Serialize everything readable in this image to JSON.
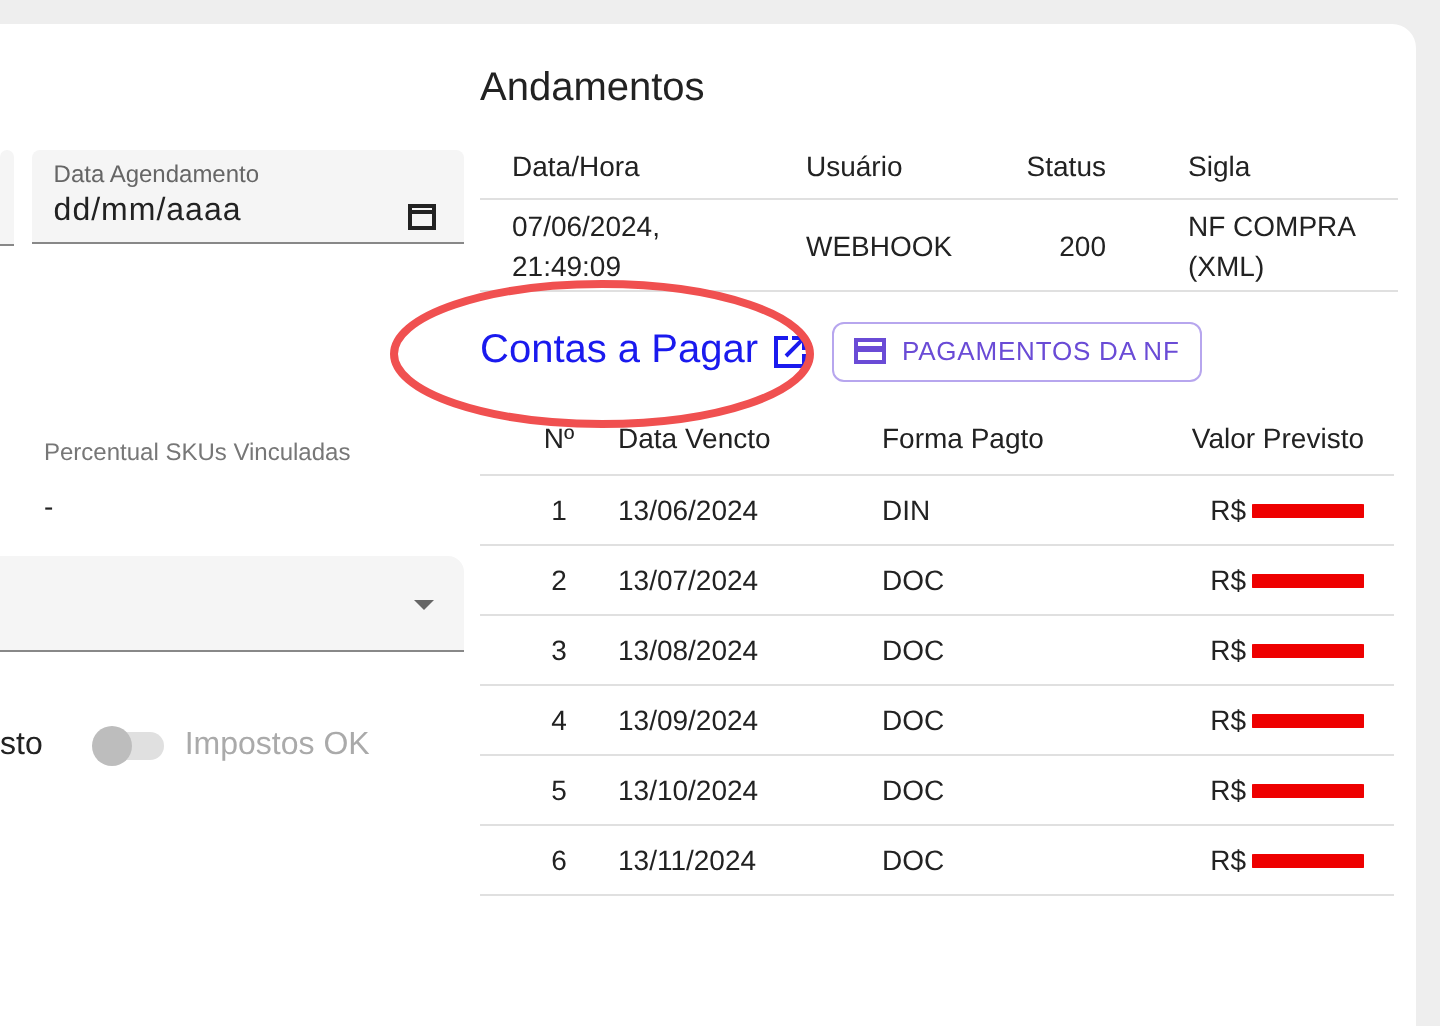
{
  "left_panel": {
    "date_field": {
      "label": "Data Agendamento",
      "placeholder": "dd/mm/aaaa"
    },
    "sku_percent": {
      "label": "Percentual SKUs Vinculadas",
      "value": "-"
    },
    "cut_label": "sto",
    "switch": {
      "label": "Impostos OK",
      "on": false,
      "disabled": true
    }
  },
  "andamentos": {
    "title": "Andamentos",
    "columns": [
      "Data/Hora",
      "Usuário",
      "Status",
      "Sigla"
    ],
    "rows": [
      [
        "07/06/2024, 21:49:09",
        "WEBHOOK",
        "200",
        "NF COMPRA (XML)"
      ]
    ]
  },
  "contas_link": "Contas a Pagar",
  "pagamentos_button": "PAGAMENTOS DA NF",
  "installments": {
    "columns": [
      "Nº",
      "Data Vencto",
      "Forma Pagto",
      "Valor Previsto"
    ],
    "rows": [
      {
        "n": "1",
        "due": "13/06/2024",
        "method": "DIN",
        "value": "R$",
        "redacted": true
      },
      {
        "n": "2",
        "due": "13/07/2024",
        "method": "DOC",
        "value": "R$",
        "redacted": true
      },
      {
        "n": "3",
        "due": "13/08/2024",
        "method": "DOC",
        "value": "R$",
        "redacted": true
      },
      {
        "n": "4",
        "due": "13/09/2024",
        "method": "DOC",
        "value": "R$",
        "redacted": true
      },
      {
        "n": "5",
        "due": "13/10/2024",
        "method": "DOC",
        "value": "R$",
        "redacted": true
      },
      {
        "n": "6",
        "due": "13/11/2024",
        "method": "DOC",
        "value": "R$",
        "redacted": true
      }
    ]
  }
}
